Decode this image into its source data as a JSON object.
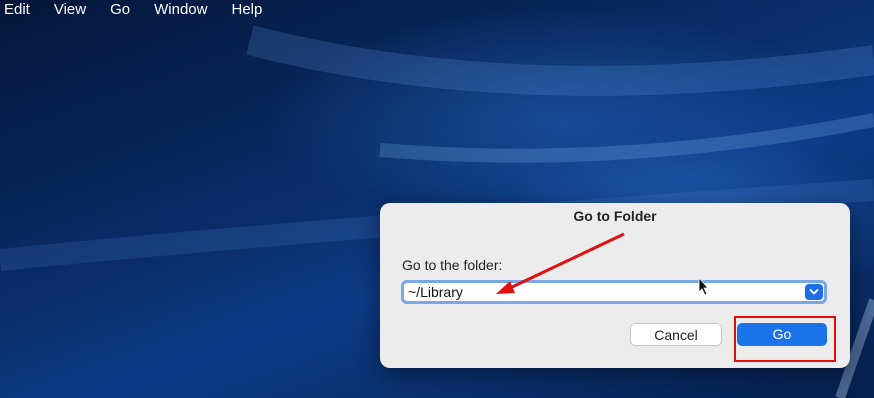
{
  "menubar": {
    "items": [
      {
        "label": "Edit"
      },
      {
        "label": "View"
      },
      {
        "label": "Go"
      },
      {
        "label": "Window"
      },
      {
        "label": "Help"
      }
    ]
  },
  "dialog": {
    "title": "Go to Folder",
    "field_label": "Go to the folder:",
    "path_value": "~/Library",
    "dropdown_icon": "chevron-down-icon",
    "cancel_label": "Cancel",
    "go_label": "Go"
  },
  "colors": {
    "accent": "#1a73e8",
    "annotation": "#e01010",
    "dialog_bg": "#ececec"
  }
}
